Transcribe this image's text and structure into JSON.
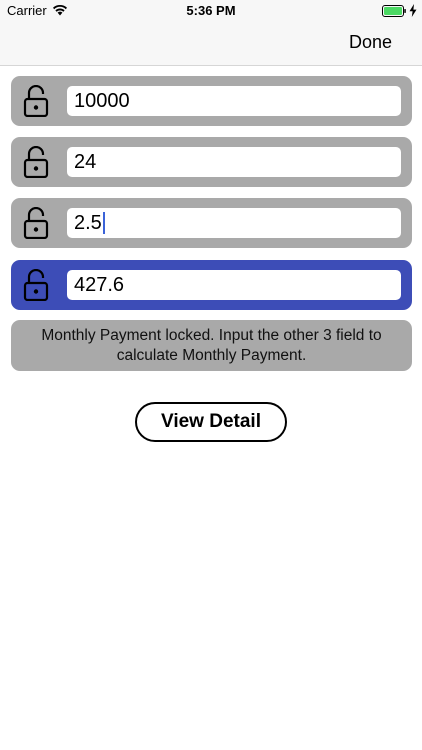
{
  "status_bar": {
    "carrier": "Carrier",
    "time": "5:36 PM",
    "battery_color": "#4cd964"
  },
  "nav": {
    "done_label": "Done"
  },
  "fields": [
    {
      "name": "loan-amount",
      "value": "10000",
      "locked": false,
      "icon": "unlocked-lock-icon"
    },
    {
      "name": "term",
      "value": "24",
      "locked": false,
      "icon": "unlocked-lock-icon"
    },
    {
      "name": "interest-rate",
      "value": "2.5",
      "locked": false,
      "icon": "unlocked-lock-icon",
      "focused": true
    },
    {
      "name": "monthly-payment",
      "value": "427.6",
      "locked": true,
      "icon": "unlocked-lock-icon"
    }
  ],
  "info": {
    "message": "Monthly Payment locked. Input the other 3 field to calculate Monthly Payment."
  },
  "actions": {
    "view_detail_label": "View Detail"
  },
  "colors": {
    "row_gray": "#a9a9a9",
    "locked_blue": "#3d4db7",
    "caret_blue": "#3b63d8"
  }
}
